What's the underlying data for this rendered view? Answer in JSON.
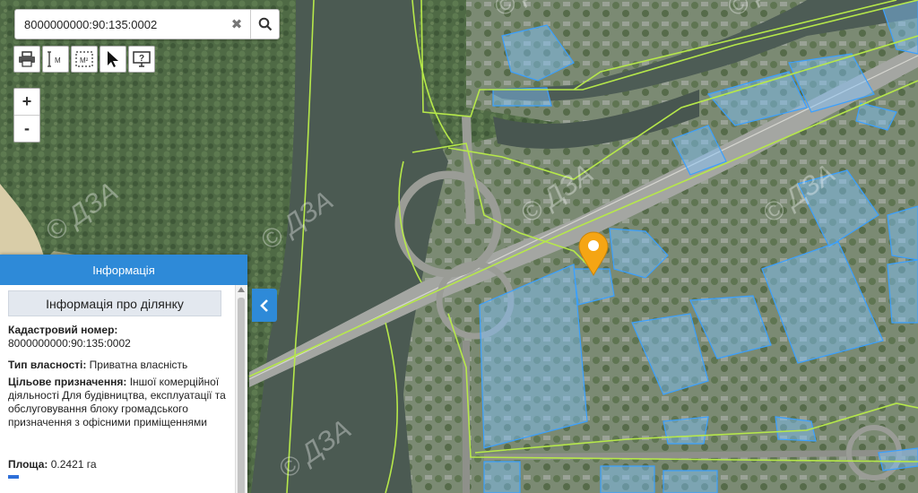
{
  "search": {
    "value": "8000000000:90:135:0002",
    "placeholder": ""
  },
  "toolbar": {
    "tools": [
      {
        "name": "print-tool",
        "icon": "printer-icon"
      },
      {
        "name": "measure-distance-tool",
        "icon": "ruler-m-icon",
        "text": "M"
      },
      {
        "name": "measure-area-tool",
        "icon": "area-m2-icon",
        "text": "M²"
      },
      {
        "name": "select-tool",
        "icon": "cursor-arrow-icon"
      },
      {
        "name": "help-tool",
        "icon": "help-monitor-icon",
        "text": "?"
      }
    ]
  },
  "zoom": {
    "in": "+",
    "out": "-"
  },
  "watermark": "© ДЗА",
  "panel": {
    "header": "Інформація",
    "title": "Інформація про ділянку",
    "cadastral_label": "Кадастровий номер:",
    "cadastral_value": "8000000000:90:135:0002",
    "ownership_label": "Тип власності:",
    "ownership_value": "Приватна власність",
    "purpose_label": "Цільове призначення:",
    "purpose_value": "Іншої комерційної діяльності Для будівництва, експлуатації та обслуговування блоку громадського призначення з офісними приміщеннями",
    "area_label": "Площа:",
    "area_value": "0.2421 га"
  },
  "colors": {
    "parcel_fill": "#7fc4ff",
    "parcel_stroke": "#3aa0ff",
    "boundary": "#b6e84a",
    "marker": "#f5a514",
    "panel_header": "#2e8ad8"
  }
}
